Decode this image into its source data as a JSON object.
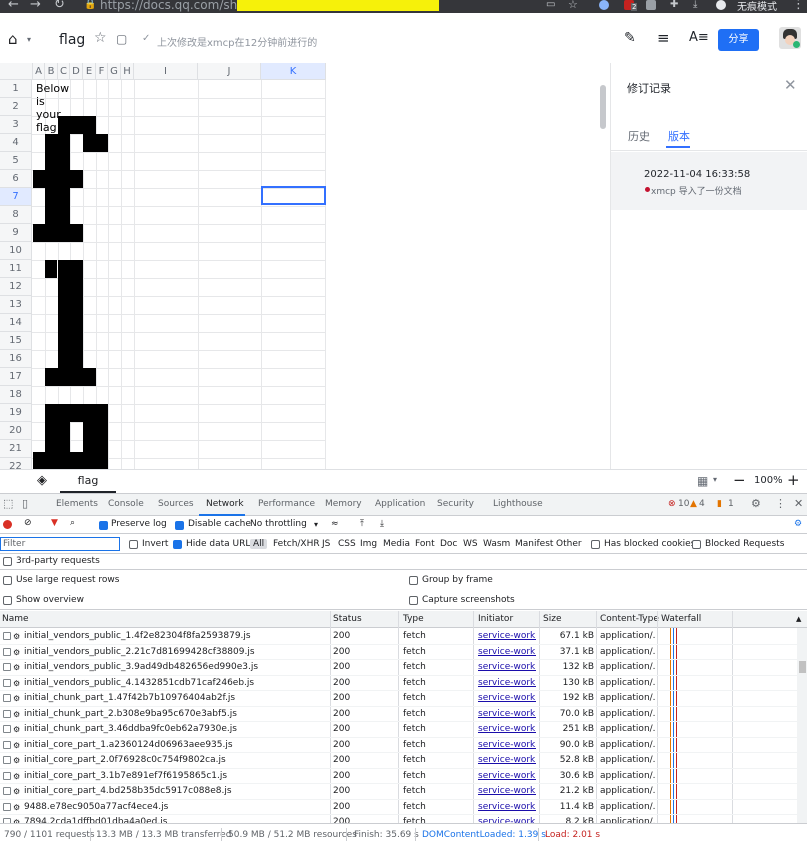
{
  "browser": {
    "url": "https://docs.qq.com/sheet/",
    "incognito_label": "无痕模式",
    "ext_badge": "2"
  },
  "header": {
    "title": "flag",
    "saved_status": "上次修改是xmcp在12分钟前进行的",
    "share_label": "分享"
  },
  "sheet": {
    "columns": [
      "A",
      "B",
      "C",
      "D",
      "E",
      "F",
      "G",
      "H",
      "I",
      "J",
      "K"
    ],
    "rows": [
      "1",
      "2",
      "3",
      "4",
      "5",
      "6",
      "7",
      "8",
      "9",
      "10",
      "11",
      "12",
      "13",
      "14",
      "15",
      "16",
      "17",
      "18",
      "19",
      "20",
      "21",
      "22"
    ],
    "a1_text": "Below is your flag",
    "tab_name": "flag",
    "zoom": "100%"
  },
  "revision_panel": {
    "title": "修订记录",
    "tab_history": "历史",
    "tab_versions": "版本",
    "entry_date": "2022-11-04 16:33:58",
    "entry_text": "xmcp 导入了一份文档"
  },
  "devtools": {
    "tabs": [
      "Elements",
      "Console",
      "Sources",
      "Network",
      "Performance",
      "Memory",
      "Application",
      "Security",
      "Lighthouse"
    ],
    "active_tab": "Network",
    "errors": "10",
    "warnings": "4",
    "issues": "1",
    "toolbar": {
      "preserve_log": "Preserve log",
      "disable_cache": "Disable cache",
      "throttling": "No throttling"
    },
    "filter": {
      "placeholder": "Filter",
      "invert": "Invert",
      "hide_data_urls": "Hide data URLs",
      "types": [
        "All",
        "Fetch/XHR",
        "JS",
        "CSS",
        "Img",
        "Media",
        "Font",
        "Doc",
        "WS",
        "Wasm",
        "Manifest",
        "Other"
      ],
      "has_blocked_cookies": "Has blocked cookies",
      "blocked_requests": "Blocked Requests",
      "third_party": "3rd-party requests"
    },
    "options": {
      "large_rows": "Use large request rows",
      "group_by_frame": "Group by frame",
      "show_overview": "Show overview",
      "capture_screenshots": "Capture screenshots"
    },
    "columns": [
      "Name",
      "Status",
      "Type",
      "Initiator",
      "Size",
      "Content-Type",
      "Waterfall"
    ],
    "requests": [
      {
        "name": "initial_vendors_public_1.4f2e82304f8fa2593879.js",
        "status": "200",
        "type": "fetch",
        "initiator": "service-work...",
        "size": "67.1 kB",
        "ctype": "application/..."
      },
      {
        "name": "initial_vendors_public_2.21c7d81699428cf38809.js",
        "status": "200",
        "type": "fetch",
        "initiator": "service-work...",
        "size": "37.1 kB",
        "ctype": "application/..."
      },
      {
        "name": "initial_vendors_public_3.9ad49db482656ed990e3.js",
        "status": "200",
        "type": "fetch",
        "initiator": "service-work...",
        "size": "132 kB",
        "ctype": "application/..."
      },
      {
        "name": "initial_vendors_public_4.1432851cdb71caf246eb.js",
        "status": "200",
        "type": "fetch",
        "initiator": "service-work...",
        "size": "130 kB",
        "ctype": "application/..."
      },
      {
        "name": "initial_chunk_part_1.47f42b7b10976404ab2f.js",
        "status": "200",
        "type": "fetch",
        "initiator": "service-work...",
        "size": "192 kB",
        "ctype": "application/..."
      },
      {
        "name": "initial_chunk_part_2.b308e9ba95c670e3abf5.js",
        "status": "200",
        "type": "fetch",
        "initiator": "service-work...",
        "size": "70.0 kB",
        "ctype": "application/..."
      },
      {
        "name": "initial_chunk_part_3.46ddba9fc0eb62a7930e.js",
        "status": "200",
        "type": "fetch",
        "initiator": "service-work...",
        "size": "251 kB",
        "ctype": "application/..."
      },
      {
        "name": "initial_core_part_1.a2360124d06963aee935.js",
        "status": "200",
        "type": "fetch",
        "initiator": "service-work...",
        "size": "90.0 kB",
        "ctype": "application/..."
      },
      {
        "name": "initial_core_part_2.0f76928c0c754f9802ca.js",
        "status": "200",
        "type": "fetch",
        "initiator": "service-work...",
        "size": "52.8 kB",
        "ctype": "application/..."
      },
      {
        "name": "initial_core_part_3.1b7e891ef7f6195865c1.js",
        "status": "200",
        "type": "fetch",
        "initiator": "service-work...",
        "size": "30.6 kB",
        "ctype": "application/..."
      },
      {
        "name": "initial_core_part_4.bd258b35dc5917c088e8.js",
        "status": "200",
        "type": "fetch",
        "initiator": "service-work...",
        "size": "21.2 kB",
        "ctype": "application/..."
      },
      {
        "name": "9488.e78ec9050a77acf4ece4.js",
        "status": "200",
        "type": "fetch",
        "initiator": "service-work...",
        "size": "11.4 kB",
        "ctype": "application/..."
      },
      {
        "name": "7894.2cda1dffbd01dba4a0ed.js",
        "status": "200",
        "type": "fetch",
        "initiator": "service-work...",
        "size": "8.2 kB",
        "ctype": "application/..."
      }
    ],
    "status_bar": {
      "requests": "790 / 1101 requests",
      "transferred": "13.3 MB / 13.3 MB transferred",
      "resources": "50.9 MB / 51.2 MB resources",
      "finish": "Finish: 35.69 s",
      "dcl": "DOMContentLoaded: 1.39 s",
      "load": "Load: 2.01 s"
    }
  },
  "colors": {
    "accent": "#1f6ff5",
    "selection": "#3370ff",
    "devtools_blue": "#1a73e8",
    "error_red": "#c5221f"
  }
}
